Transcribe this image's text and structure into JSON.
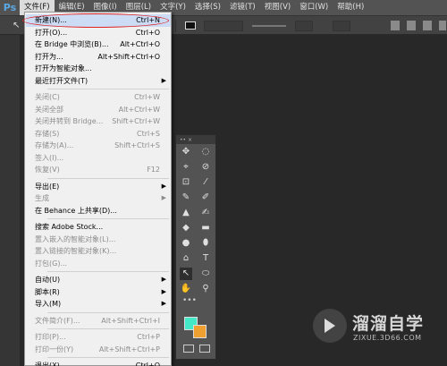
{
  "app": {
    "logo": "Ps"
  },
  "menubar": {
    "items": [
      {
        "label": "文件(F)",
        "active": true
      },
      {
        "label": "编辑(E)"
      },
      {
        "label": "图像(I)"
      },
      {
        "label": "图层(L)"
      },
      {
        "label": "文字(Y)"
      },
      {
        "label": "选择(S)"
      },
      {
        "label": "滤镜(T)"
      },
      {
        "label": "视图(V)"
      },
      {
        "label": "窗口(W)"
      },
      {
        "label": "帮助(H)"
      }
    ]
  },
  "file_menu": {
    "items": [
      {
        "label": "新建(N)...",
        "shortcut": "Ctrl+N",
        "highlighted": true
      },
      {
        "label": "打开(O)...",
        "shortcut": "Ctrl+O"
      },
      {
        "label": "在 Bridge 中浏览(B)...",
        "shortcut": "Alt+Ctrl+O"
      },
      {
        "label": "打开为...",
        "shortcut": "Alt+Shift+Ctrl+O"
      },
      {
        "label": "打开为智能对象..."
      },
      {
        "label": "最近打开文件(T)",
        "submenu": true
      },
      {
        "sep": true
      },
      {
        "label": "关闭(C)",
        "shortcut": "Ctrl+W",
        "disabled": true
      },
      {
        "label": "关闭全部",
        "shortcut": "Alt+Ctrl+W",
        "disabled": true
      },
      {
        "label": "关闭并转到 Bridge...",
        "shortcut": "Shift+Ctrl+W",
        "disabled": true
      },
      {
        "label": "存储(S)",
        "shortcut": "Ctrl+S",
        "disabled": true
      },
      {
        "label": "存储为(A)...",
        "shortcut": "Shift+Ctrl+S",
        "disabled": true
      },
      {
        "label": "签入(I)...",
        "disabled": true
      },
      {
        "label": "恢复(V)",
        "shortcut": "F12",
        "disabled": true
      },
      {
        "sep": true
      },
      {
        "label": "导出(E)",
        "submenu": true
      },
      {
        "label": "生成",
        "submenu": true,
        "disabled": true
      },
      {
        "label": "在 Behance 上共享(D)..."
      },
      {
        "sep": true
      },
      {
        "label": "搜索 Adobe Stock..."
      },
      {
        "label": "置入嵌入的智能对象(L)...",
        "disabled": true
      },
      {
        "label": "置入链接的智能对象(K)...",
        "disabled": true
      },
      {
        "label": "打包(G)...",
        "disabled": true
      },
      {
        "sep": true
      },
      {
        "label": "自动(U)",
        "submenu": true
      },
      {
        "label": "脚本(R)",
        "submenu": true
      },
      {
        "label": "导入(M)",
        "submenu": true
      },
      {
        "sep": true
      },
      {
        "label": "文件简介(F)...",
        "shortcut": "Alt+Shift+Ctrl+I",
        "disabled": true
      },
      {
        "sep": true
      },
      {
        "label": "打印(P)...",
        "shortcut": "Ctrl+P",
        "disabled": true
      },
      {
        "label": "打印一份(Y)",
        "shortcut": "Alt+Shift+Ctrl+P",
        "disabled": true
      },
      {
        "sep": true
      },
      {
        "label": "退出(X)",
        "shortcut": "Ctrl+Q"
      }
    ]
  },
  "tools_panel": {
    "header": "••  ×",
    "tools": [
      [
        "✥",
        "◌"
      ],
      [
        "⌖",
        "⊘"
      ],
      [
        "⊡",
        "⁄"
      ],
      [
        "✎",
        "✐"
      ],
      [
        "▲",
        "✍"
      ],
      [
        "◆",
        "▬"
      ],
      [
        "●",
        "⬮"
      ],
      [
        "⌂",
        "T"
      ],
      [
        "↖",
        "⬭"
      ],
      [
        "✋",
        "⚲"
      ]
    ],
    "more": "•••",
    "foreground_color": "#44eac7",
    "background_color": "#f0a030"
  },
  "watermark": {
    "name": "溜溜自学",
    "url": "ZIXUE.3D66.COM"
  }
}
